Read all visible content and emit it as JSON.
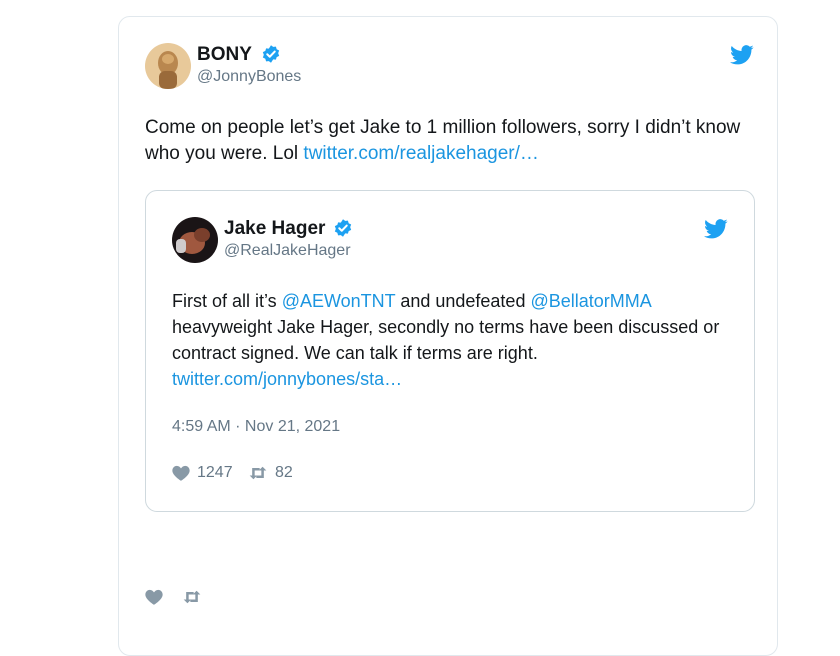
{
  "tweet": {
    "author_name": "BONY",
    "author_handle": "@JonnyBones",
    "text_before": "Come on people let’s get Jake to 1 million followers, sorry I didn’t know who you were. Lol ",
    "link_text": "twitter.com/realjakehager/…",
    "colors": {
      "link": "#1b95e0",
      "verified": "#1da1f2",
      "bird": "#1da1f2",
      "muted": "#657786"
    }
  },
  "quoted": {
    "author_name": "Jake Hager",
    "author_handle": "@RealJakeHager",
    "text_1": "First of all it’s ",
    "mention_1": "@AEWonTNT",
    "text_2": " and undefeated ",
    "mention_2": "@BellatorMMA",
    "text_3": " heavyweight Jake Hager, secondly no terms have been discussed or contract signed. We can talk if terms are right. ",
    "link_text": "twitter.com/jonnybones/sta…",
    "timestamp": "4:59 AM · Nov 21, 2021",
    "likes": "1247",
    "retweets": "82"
  },
  "icons": [
    "twitter-bird-icon",
    "verified-badge-icon",
    "heart-icon",
    "retweet-icon"
  ]
}
